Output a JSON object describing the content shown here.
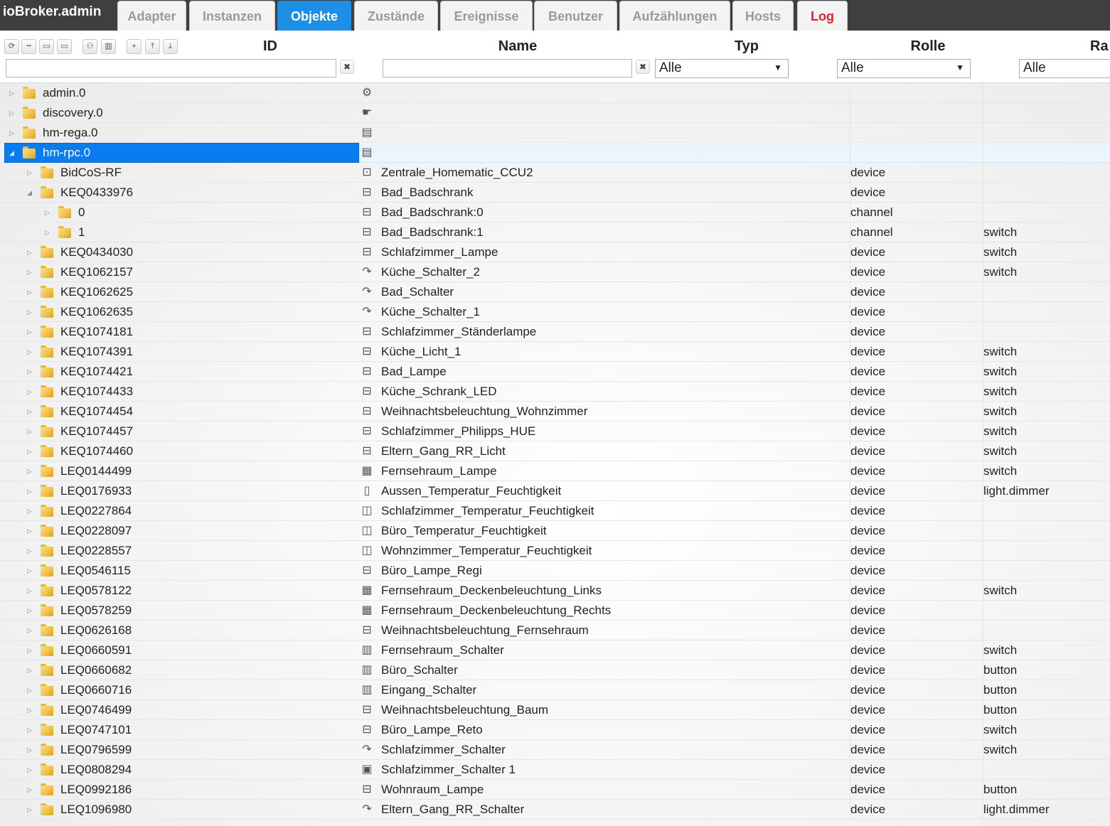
{
  "brand": "ioBroker.admin",
  "tabs": [
    {
      "label": "Adapter",
      "key": "adapter"
    },
    {
      "label": "Instanzen",
      "key": "instanzen"
    },
    {
      "label": "Objekte",
      "key": "objekte",
      "active": true
    },
    {
      "label": "Zustände",
      "key": "zustaende"
    },
    {
      "label": "Ereignisse",
      "key": "ereignisse"
    },
    {
      "label": "Benutzer",
      "key": "benutzer"
    },
    {
      "label": "Aufzählungen",
      "key": "aufzaehlungen"
    },
    {
      "label": "Hosts",
      "key": "hosts"
    },
    {
      "label": "Log",
      "key": "log"
    }
  ],
  "toolbar": [
    {
      "name": "refresh-icon",
      "glyph": "⟳"
    },
    {
      "name": "list-view-icon",
      "glyph": "┅"
    },
    {
      "name": "folder-collapse-icon",
      "glyph": "▭"
    },
    {
      "name": "folder-expand-icon",
      "glyph": "▭"
    },
    {
      "name": "user-icon",
      "glyph": "⚇"
    },
    {
      "name": "book-icon",
      "glyph": "▥"
    },
    {
      "name": "add-icon",
      "glyph": "+"
    },
    {
      "name": "upload-icon",
      "glyph": "⤒"
    },
    {
      "name": "download-icon",
      "glyph": "⤓"
    }
  ],
  "columns": {
    "id": "ID",
    "name": "Name",
    "typ": "Typ",
    "rolle": "Rolle",
    "raum": "Ra"
  },
  "filters": {
    "id_value": "",
    "name_value": "",
    "clear_glyph": "✖",
    "typ_selected": "Alle",
    "rolle_selected": "Alle",
    "raum_selected": "Alle",
    "select_arrow": "▼"
  },
  "rows": [
    {
      "level": 0,
      "toggle": "▷",
      "id": "admin.0",
      "icon": "gear-icon",
      "glyph": "⚙",
      "name": "",
      "typ": "",
      "rolle": ""
    },
    {
      "level": 0,
      "toggle": "▷",
      "id": "discovery.0",
      "icon": "hand-icon",
      "glyph": "☛",
      "name": "",
      "typ": "",
      "rolle": ""
    },
    {
      "level": 0,
      "toggle": "▷",
      "id": "hm-rega.0",
      "icon": "document-icon",
      "glyph": "▤",
      "name": "",
      "typ": "",
      "rolle": ""
    },
    {
      "level": 0,
      "toggle": "◢",
      "id": "hm-rpc.0",
      "icon": "document-icon",
      "glyph": "▤",
      "name": "",
      "typ": "",
      "rolle": "",
      "selected": true
    },
    {
      "level": 1,
      "toggle": "▷",
      "id": "BidCoS-RF",
      "icon": "ccu-icon",
      "glyph": "⊡",
      "name": "Zentrale_Homematic_CCU2",
      "typ": "device",
      "rolle": ""
    },
    {
      "level": 1,
      "toggle": "◢",
      "id": "KEQ0433976",
      "icon": "actuator-icon",
      "glyph": "⊟",
      "name": "Bad_Badschrank",
      "typ": "device",
      "rolle": ""
    },
    {
      "level": 2,
      "toggle": "▷",
      "id": "0",
      "icon": "actuator-icon",
      "glyph": "⊟",
      "name": "Bad_Badschrank:0",
      "typ": "channel",
      "rolle": ""
    },
    {
      "level": 2,
      "toggle": "▷",
      "id": "1",
      "icon": "actuator-icon",
      "glyph": "⊟",
      "name": "Bad_Badschrank:1",
      "typ": "channel",
      "rolle": "switch"
    },
    {
      "level": 1,
      "toggle": "▷",
      "id": "KEQ0434030",
      "icon": "actuator-icon",
      "glyph": "⊟",
      "name": "Schlafzimmer_Lampe",
      "typ": "device",
      "rolle": "switch"
    },
    {
      "level": 1,
      "toggle": "▷",
      "id": "KEQ1062157",
      "icon": "remote-icon",
      "glyph": "↷",
      "name": "Küche_Schalter_2",
      "typ": "device",
      "rolle": "switch"
    },
    {
      "level": 1,
      "toggle": "▷",
      "id": "KEQ1062625",
      "icon": "remote-icon",
      "glyph": "↷",
      "name": "Bad_Schalter",
      "typ": "device",
      "rolle": ""
    },
    {
      "level": 1,
      "toggle": "▷",
      "id": "KEQ1062635",
      "icon": "remote-icon",
      "glyph": "↷",
      "name": "Küche_Schalter_1",
      "typ": "device",
      "rolle": ""
    },
    {
      "level": 1,
      "toggle": "▷",
      "id": "KEQ1074181",
      "icon": "actuator-icon",
      "glyph": "⊟",
      "name": "Schlafzimmer_Ständerlampe",
      "typ": "device",
      "rolle": ""
    },
    {
      "level": 1,
      "toggle": "▷",
      "id": "KEQ1074391",
      "icon": "actuator-icon",
      "glyph": "⊟",
      "name": "Küche_Licht_1",
      "typ": "device",
      "rolle": "switch"
    },
    {
      "level": 1,
      "toggle": "▷",
      "id": "KEQ1074421",
      "icon": "actuator-icon",
      "glyph": "⊟",
      "name": "Bad_Lampe",
      "typ": "device",
      "rolle": "switch"
    },
    {
      "level": 1,
      "toggle": "▷",
      "id": "KEQ1074433",
      "icon": "actuator-icon",
      "glyph": "⊟",
      "name": "Küche_Schrank_LED",
      "typ": "device",
      "rolle": "switch"
    },
    {
      "level": 1,
      "toggle": "▷",
      "id": "KEQ1074454",
      "icon": "actuator-icon",
      "glyph": "⊟",
      "name": "Weihnachtsbeleuchtung_Wohnzimmer",
      "typ": "device",
      "rolle": "switch"
    },
    {
      "level": 1,
      "toggle": "▷",
      "id": "KEQ1074457",
      "icon": "actuator-icon",
      "glyph": "⊟",
      "name": "Schlafzimmer_Philipps_HUE",
      "typ": "device",
      "rolle": "switch"
    },
    {
      "level": 1,
      "toggle": "▷",
      "id": "KEQ1074460",
      "icon": "actuator-icon",
      "glyph": "⊟",
      "name": "Eltern_Gang_RR_Licht",
      "typ": "device",
      "rolle": "switch"
    },
    {
      "level": 1,
      "toggle": "▷",
      "id": "LEQ0144499",
      "icon": "dimmer-icon",
      "glyph": "▦",
      "name": "Fernsehraum_Lampe",
      "typ": "device",
      "rolle": "switch"
    },
    {
      "level": 1,
      "toggle": "▷",
      "id": "LEQ0176933",
      "icon": "thermometer-icon",
      "glyph": "▯",
      "name": "Aussen_Temperatur_Feuchtigkeit",
      "typ": "device",
      "rolle": "light.dimmer"
    },
    {
      "level": 1,
      "toggle": "▷",
      "id": "LEQ0227864",
      "icon": "thermostat-icon",
      "glyph": "◫",
      "name": "Schlafzimmer_Temperatur_Feuchtigkeit",
      "typ": "device",
      "rolle": ""
    },
    {
      "level": 1,
      "toggle": "▷",
      "id": "LEQ0228097",
      "icon": "thermostat-icon",
      "glyph": "◫",
      "name": "Büro_Temperatur_Feuchtigkeit",
      "typ": "device",
      "rolle": ""
    },
    {
      "level": 1,
      "toggle": "▷",
      "id": "LEQ0228557",
      "icon": "thermostat-icon",
      "glyph": "◫",
      "name": "Wohnzimmer_Temperatur_Feuchtigkeit",
      "typ": "device",
      "rolle": ""
    },
    {
      "level": 1,
      "toggle": "▷",
      "id": "LEQ0546115",
      "icon": "actuator-icon",
      "glyph": "⊟",
      "name": "Büro_Lampe_Regi",
      "typ": "device",
      "rolle": ""
    },
    {
      "level": 1,
      "toggle": "▷",
      "id": "LEQ0578122",
      "icon": "dimmer-icon",
      "glyph": "▦",
      "name": "Fernsehraum_Deckenbeleuchtung_Links",
      "typ": "device",
      "rolle": "switch"
    },
    {
      "level": 1,
      "toggle": "▷",
      "id": "LEQ0578259",
      "icon": "dimmer-icon",
      "glyph": "▦",
      "name": "Fernsehraum_Deckenbeleuchtung_Rechts",
      "typ": "device",
      "rolle": ""
    },
    {
      "level": 1,
      "toggle": "▷",
      "id": "LEQ0626168",
      "icon": "actuator-icon",
      "glyph": "⊟",
      "name": "Weihnachtsbeleuchtung_Fernsehraum",
      "typ": "device",
      "rolle": ""
    },
    {
      "level": 1,
      "toggle": "▷",
      "id": "LEQ0660591",
      "icon": "wall-switch-icon",
      "glyph": "▥",
      "name": "Fernsehraum_Schalter",
      "typ": "device",
      "rolle": "switch"
    },
    {
      "level": 1,
      "toggle": "▷",
      "id": "LEQ0660682",
      "icon": "wall-switch-icon",
      "glyph": "▥",
      "name": "Büro_Schalter",
      "typ": "device",
      "rolle": "button"
    },
    {
      "level": 1,
      "toggle": "▷",
      "id": "LEQ0660716",
      "icon": "wall-switch-icon",
      "glyph": "▥",
      "name": "Eingang_Schalter",
      "typ": "device",
      "rolle": "button"
    },
    {
      "level": 1,
      "toggle": "▷",
      "id": "LEQ0746499",
      "icon": "actuator-icon",
      "glyph": "⊟",
      "name": "Weihnachtsbeleuchtung_Baum",
      "typ": "device",
      "rolle": "button"
    },
    {
      "level": 1,
      "toggle": "▷",
      "id": "LEQ0747101",
      "icon": "actuator-icon",
      "glyph": "⊟",
      "name": "Büro_Lampe_Reto",
      "typ": "device",
      "rolle": "switch"
    },
    {
      "level": 1,
      "toggle": "▷",
      "id": "LEQ0796599",
      "icon": "remote-icon",
      "glyph": "↷",
      "name": "Schlafzimmer_Schalter",
      "typ": "device",
      "rolle": "switch"
    },
    {
      "level": 1,
      "toggle": "▷",
      "id": "LEQ0808294",
      "icon": "push-button-icon",
      "glyph": "▣",
      "name": "Schlafzimmer_Schalter 1",
      "typ": "device",
      "rolle": ""
    },
    {
      "level": 1,
      "toggle": "▷",
      "id": "LEQ0992186",
      "icon": "actuator-icon",
      "glyph": "⊟",
      "name": "Wohnraum_Lampe",
      "typ": "device",
      "rolle": "button"
    },
    {
      "level": 1,
      "toggle": "▷",
      "id": "LEQ1096980",
      "icon": "remote-icon",
      "glyph": "↷",
      "name": "Eltern_Gang_RR_Schalter",
      "typ": "device",
      "rolle": "light.dimmer"
    }
  ]
}
